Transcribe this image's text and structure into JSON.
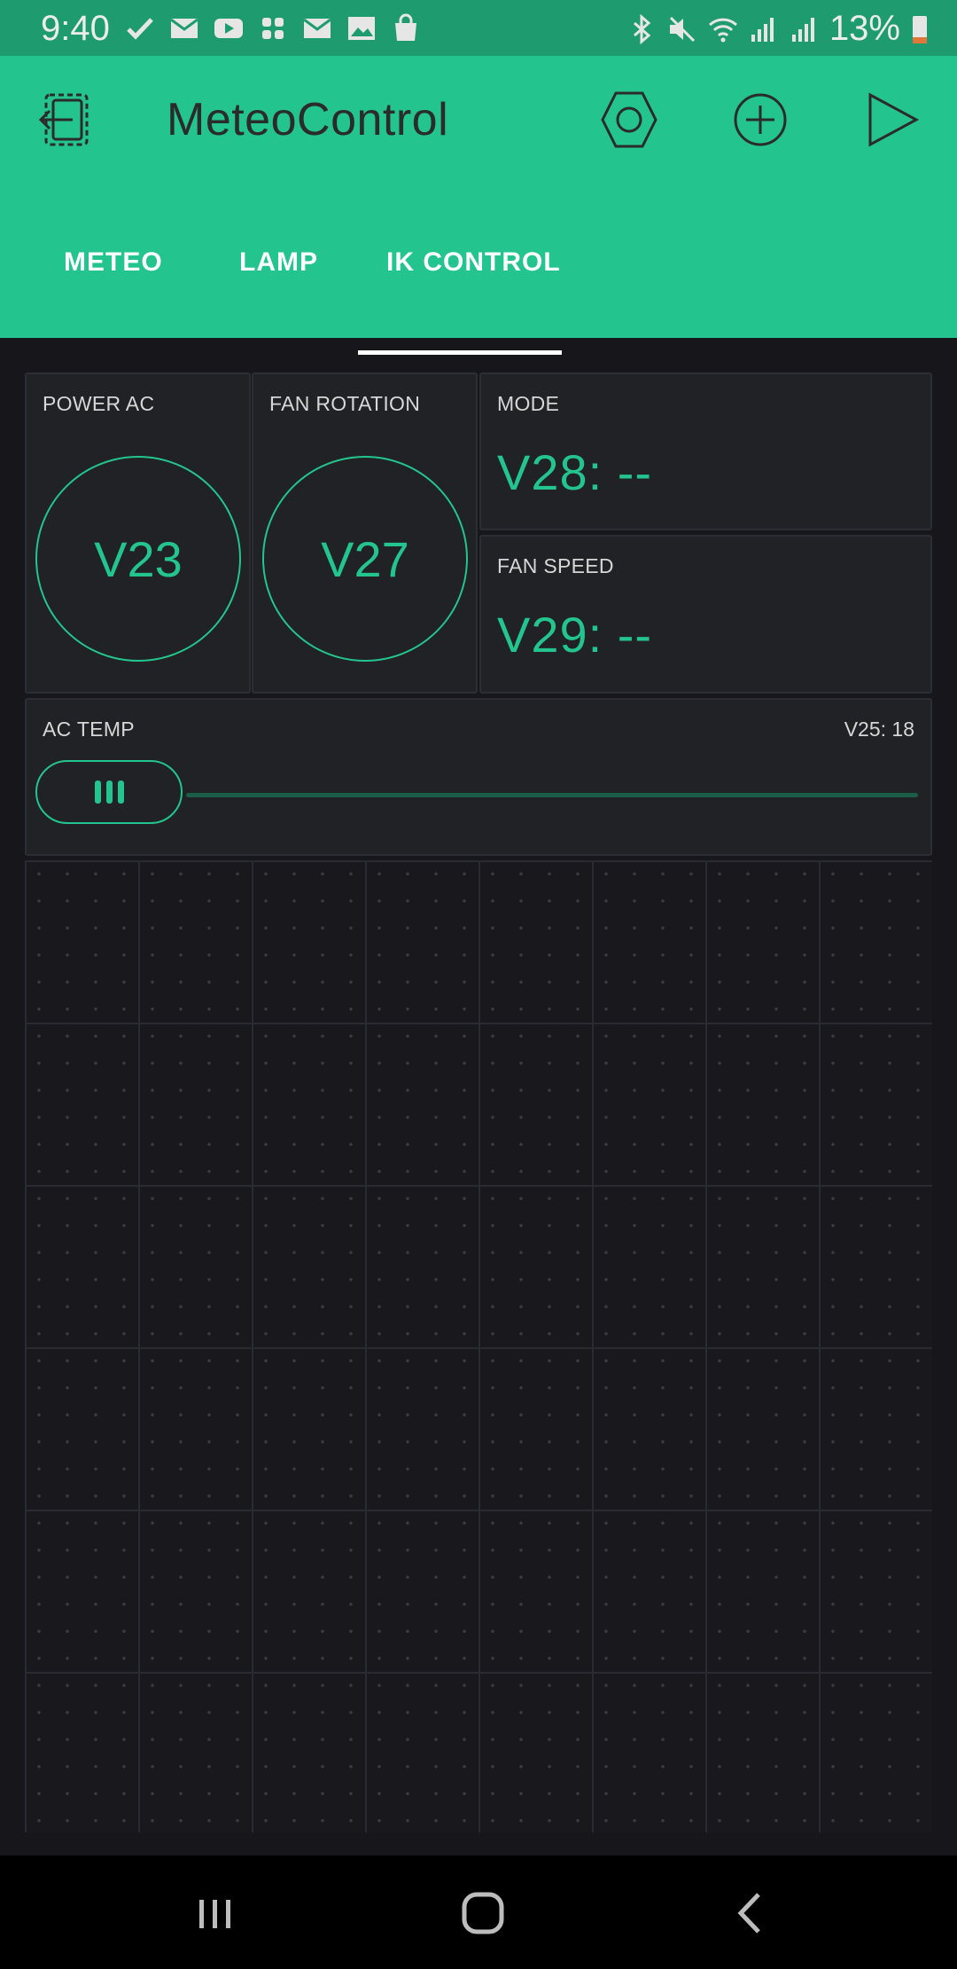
{
  "status_bar": {
    "time": "9:40",
    "battery_percent": "13%",
    "notification_icons": [
      "check-icon",
      "mail-icon",
      "youtube-icon",
      "slack-icon",
      "mail-icon",
      "gallery-icon",
      "shopping-bag-icon"
    ],
    "system_icons": [
      "bluetooth-icon",
      "mute-icon",
      "wifi-icon",
      "signal-icon",
      "signal-icon",
      "battery-icon"
    ]
  },
  "app_bar": {
    "title": "MeteoControl",
    "icons": [
      "exit-icon",
      "settings-hex-icon",
      "add-icon",
      "play-icon"
    ]
  },
  "tabs": [
    {
      "label": "METEO",
      "active": false
    },
    {
      "label": "LAMP",
      "active": false
    },
    {
      "label": "IK CONTROL",
      "active": true
    }
  ],
  "widgets": {
    "power_ac": {
      "label": "POWER AC",
      "button_text": "V23"
    },
    "fan_rotation": {
      "label": "FAN ROTATION",
      "button_text": "V27"
    },
    "mode": {
      "label": "MODE",
      "value": "V28: --"
    },
    "fan_speed": {
      "label": "FAN SPEED",
      "value": "V29: --"
    },
    "ac_temp": {
      "label": "AC TEMP",
      "value": "V25: 18",
      "slider_level": 0
    }
  },
  "colors": {
    "accent": "#23c48e",
    "status_bar": "#1f9c6f",
    "background": "#17171b",
    "widget": "#212226"
  }
}
